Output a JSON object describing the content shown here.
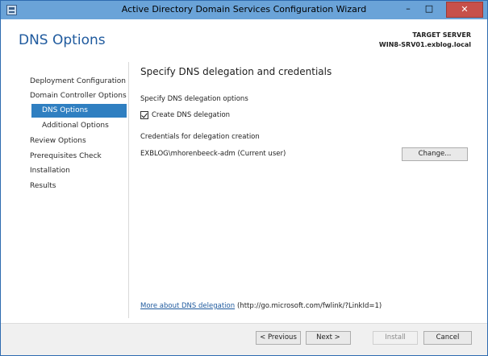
{
  "window": {
    "title": "Active Directory Domain Services Configuration Wizard",
    "minimize_glyph": "–",
    "maximize_glyph": "□",
    "close_glyph": "✕"
  },
  "header": {
    "page_title": "DNS Options",
    "target_server_label": "TARGET SERVER",
    "target_server_name": "WIN8-SRV01.exblog.local"
  },
  "nav": {
    "items": [
      {
        "label": "Deployment Configuration"
      },
      {
        "label": "Domain Controller Options"
      },
      {
        "label": "DNS Options",
        "active": true
      },
      {
        "label": "Additional Options"
      },
      {
        "label": "Review Options"
      },
      {
        "label": "Prerequisites Check"
      },
      {
        "label": "Installation"
      },
      {
        "label": "Results"
      }
    ]
  },
  "main": {
    "section_title": "Specify DNS delegation and credentials",
    "delegation_options_label": "Specify DNS delegation options",
    "create_delegation_checkbox": {
      "label": "Create DNS delegation",
      "checked": true
    },
    "credentials_label": "Credentials for delegation creation",
    "credentials_user": "EXBLOG\\mhorenbeeck-adm (Current user)",
    "change_button": "Change...",
    "help_link_text": "More about DNS delegation",
    "help_link_url": "(http://go.microsoft.com/fwlink/?LinkId=1)"
  },
  "footer": {
    "previous_button": "< Previous",
    "next_button": "Next >",
    "install_button": "Install",
    "cancel_button": "Cancel"
  },
  "colors": {
    "titlebar": "#6aa3d8",
    "accent": "#1f5a9e",
    "nav_active": "#2f7fc1",
    "close_button": "#c7504a"
  },
  "icons": {
    "window_icon": "ad-wizard-icon"
  }
}
